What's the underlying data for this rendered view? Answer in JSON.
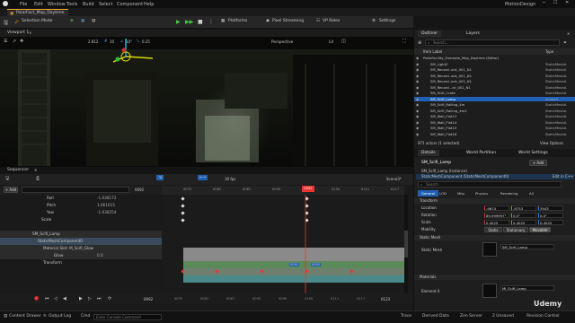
{
  "menu": {
    "items": [
      "File",
      "Edit",
      "Window",
      "Tools",
      "Build",
      "Select",
      "Component",
      "Help"
    ],
    "project": "MotionDesign"
  },
  "tab": {
    "label": "PolarFact_Map_Daytime"
  },
  "toolbar": {
    "selection_mode": "Selection Mode",
    "platforms": "Platforms",
    "pixel_streaming": "Pixel Streaming",
    "vp_roles": "VP Roles",
    "settings": "Settings"
  },
  "viewport": {
    "tab": "Viewport 1",
    "perspective": "Perspective",
    "lit": "Lit",
    "grid": "10",
    "rot": "10°",
    "scale": "0.25",
    "speed": "2.812"
  },
  "outliner": {
    "tabs": [
      "Outliner",
      "Layers"
    ],
    "search_placeholder": "Search...",
    "col_label": "Item Label",
    "col_type": "Type",
    "status": "971 actors (1 selected)",
    "view_options": "View Options",
    "rows": [
      {
        "label": "PolarFacility_Example_Map_Daytime (Editor)",
        "type": "",
        "sel": false,
        "lvl": 0
      },
      {
        "label": "SM_Light2",
        "type": "StaticMeshA",
        "sel": false,
        "lvl": 1
      },
      {
        "label": "SM_Record..ock_001_N1",
        "type": "StaticMeshA",
        "sel": false,
        "lvl": 1
      },
      {
        "label": "SM_Record..ock_001_N1",
        "type": "StaticMeshA",
        "sel": false,
        "lvl": 1
      },
      {
        "label": "SM_Record..ock_001_N1",
        "type": "StaticMeshA",
        "sel": false,
        "lvl": 1
      },
      {
        "label": "SM_Record...ck_001_N1",
        "type": "StaticMeshA",
        "sel": false,
        "lvl": 1
      },
      {
        "label": "SM_Scifi_Crate",
        "type": "StaticMeshA",
        "sel": false,
        "lvl": 1
      },
      {
        "label": "SM_Scifi_Lamp",
        "type": "Scene3",
        "sel": true,
        "lvl": 1
      },
      {
        "label": "SM_Scifi_Railing_4m",
        "type": "StaticMeshA",
        "sel": false,
        "lvl": 1
      },
      {
        "label": "SM_Scifi_Railing_4m2",
        "type": "StaticMeshA",
        "sel": false,
        "lvl": 1
      },
      {
        "label": "SM_Wall_Flat13",
        "type": "StaticMeshA",
        "sel": false,
        "lvl": 1
      },
      {
        "label": "SM_Wall_Flat14",
        "type": "StaticMeshA",
        "sel": false,
        "lvl": 1
      },
      {
        "label": "SM_Wall_Flat15",
        "type": "StaticMeshA",
        "sel": false,
        "lvl": 1
      },
      {
        "label": "SM_Wall_Flat16",
        "type": "StaticMeshA",
        "sel": false,
        "lvl": 1
      }
    ]
  },
  "details": {
    "tabs": [
      "Details",
      "World Partition",
      "World Settings"
    ],
    "actor": "SM_Scifi_Lamp",
    "add": "+ Add",
    "instance": "SM_Scifi_Lamp (Instance)",
    "component": "StaticMeshComponent (StaticMeshComponent0)",
    "edit_cpp": "Edit in C++",
    "search_placeholder": "Search",
    "filter_tabs": [
      "General",
      "LOD",
      "Misc",
      "Physics",
      "Rendering",
      "All"
    ],
    "transform": "Transform",
    "location": {
      "label": "Location",
      "x": "-9674",
      "y": "-9753",
      "z": "3943"
    },
    "rotation": {
      "label": "Rotation",
      "x": "89.999997°",
      "y": "0.0°",
      "z": "0.0°"
    },
    "scale": {
      "label": "Scale",
      "x": "0.4025",
      "y": "0.4025",
      "z": "0.4025"
    },
    "mobility": {
      "label": "Mobility",
      "options": [
        "Static",
        "Stationary",
        "Movable"
      ]
    },
    "static_mesh_section": "Static Mesh",
    "static_mesh_label": "Static Mesh",
    "static_mesh_value": "SM_Scifi_Lamp",
    "materials_section": "Materials",
    "element_label": "Element 0",
    "material_value": "MI_Scifi_Lamp"
  },
  "sequencer": {
    "tab": "Sequencer",
    "track_btn": "+ Add",
    "fps": "30 fps",
    "frame": "0092",
    "scene": "Scene3*",
    "marker": "0092",
    "rows": [
      {
        "label": "Roll",
        "value": "-1.638172",
        "indent": 28
      },
      {
        "label": "Pitch",
        "value": "1.661615",
        "indent": 28
      },
      {
        "label": "Yaw",
        "value": "-1.938254",
        "indent": 28
      },
      {
        "label": "Scale",
        "value": "",
        "indent": 22
      },
      {
        "label": "SM_Scifi_Lamp",
        "value": "",
        "indent": 12
      },
      {
        "label": "StaticMeshComponent0",
        "value": "",
        "indent": 18
      },
      {
        "label": "Material Slot: M_Scifi_Glow",
        "value": "",
        "indent": 24
      },
      {
        "label": "Glow",
        "value": "0.0",
        "indent": 36
      },
      {
        "label": "Transform",
        "value": "",
        "indent": 24
      }
    ],
    "ticks": [
      "0075",
      "0081",
      "0087",
      "0093",
      "0099",
      "0105",
      "0111",
      "0117"
    ],
    "bottom_ticks": [
      "0075",
      "0081",
      "0087",
      "0093",
      "0099",
      "0105",
      "0111",
      "0117"
    ],
    "start": "0092",
    "end": "0123"
  },
  "statusbar": {
    "content_drawer": "Content Drawer",
    "output_log": "Output Log",
    "cmd": "Cmd",
    "console_placeholder": "Enter Console Command",
    "trace": "Trace",
    "derived": "Derived Data",
    "zen": "Zen Server",
    "unsaved": "2 Unsaved",
    "revision": "Revision Control"
  },
  "watermark": "Udemy"
}
